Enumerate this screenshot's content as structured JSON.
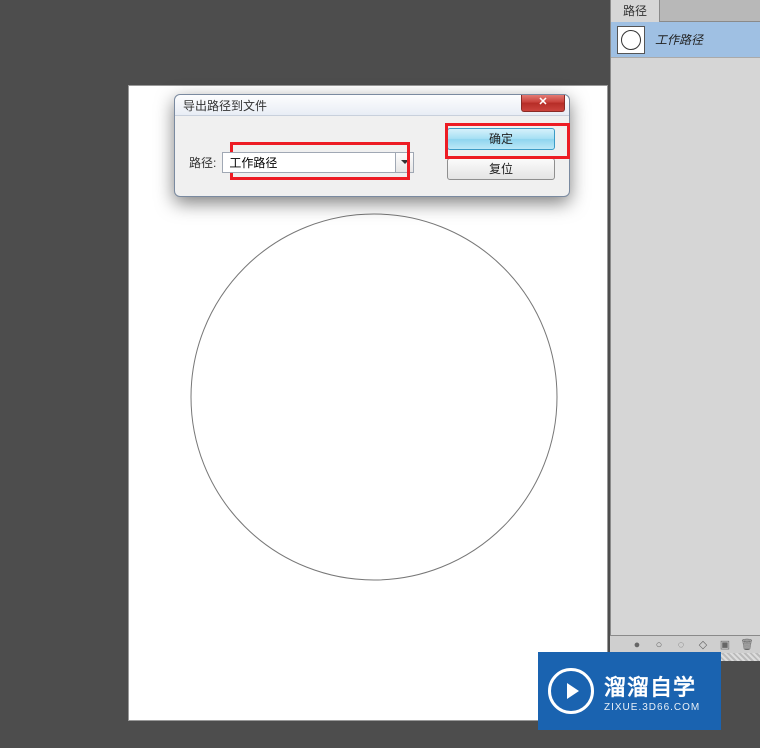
{
  "panel": {
    "tab_label": "路径",
    "path_item_label": "工作路径"
  },
  "dialog": {
    "title": "导出路径到文件",
    "field_label": "路径:",
    "field_value": "工作路径",
    "ok_label": "确定",
    "reset_label": "复位",
    "close_glyph": "✕"
  },
  "watermark": {
    "main": "溜溜自学",
    "sub": "ZIXUE.3D66.COM"
  }
}
